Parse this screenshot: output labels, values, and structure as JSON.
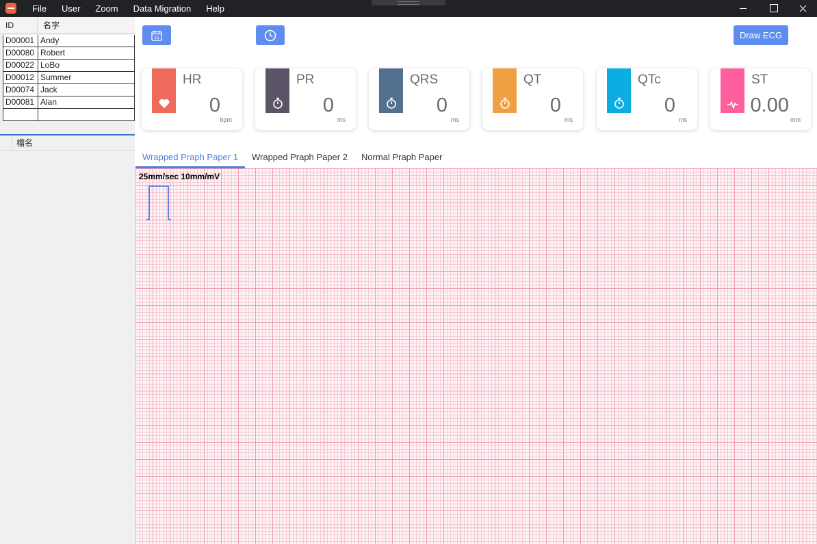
{
  "menu": [
    "File",
    "User",
    "Zoom",
    "Data Migration",
    "Help"
  ],
  "patients": {
    "headers": {
      "id": "ID",
      "name": "名字"
    },
    "rows": [
      {
        "id": "D00001",
        "name": "Andy"
      },
      {
        "id": "D00080",
        "name": "Robert"
      },
      {
        "id": "D00022",
        "name": "LoBo"
      },
      {
        "id": "D00012",
        "name": "Summer"
      },
      {
        "id": "D00074",
        "name": "Jack"
      },
      {
        "id": "D00081",
        "name": "Alan"
      }
    ]
  },
  "files": {
    "header": "檔名"
  },
  "toolbar": {
    "draw_label": "Draw ECG",
    "calendar_day": "15"
  },
  "metrics": [
    {
      "name": "HR",
      "value": "0",
      "unit": "bpm",
      "color": "#ee6b5c",
      "icon": "heart-icon"
    },
    {
      "name": "PR",
      "value": "0",
      "unit": "ms",
      "color": "#5a5466",
      "icon": "stopwatch-icon"
    },
    {
      "name": "QRS",
      "value": "0",
      "unit": "ms",
      "color": "#537090",
      "icon": "stopwatch-icon"
    },
    {
      "name": "QT",
      "value": "0",
      "unit": "ms",
      "color": "#f0a040",
      "icon": "stopwatch-icon"
    },
    {
      "name": "QTc",
      "value": "0",
      "unit": "ms",
      "color": "#0aaee0",
      "icon": "stopwatch-icon"
    },
    {
      "name": "ST",
      "value": "0.00",
      "unit": "mm",
      "color": "#ff5f9c",
      "icon": "pulse-icon"
    }
  ],
  "tabs": [
    "Wrapped Praph Paper 1",
    "Wrapped Praph Paper 2",
    "Normal Praph Paper"
  ],
  "graph": {
    "scale_label": "25mm/sec 10mm/mV"
  }
}
